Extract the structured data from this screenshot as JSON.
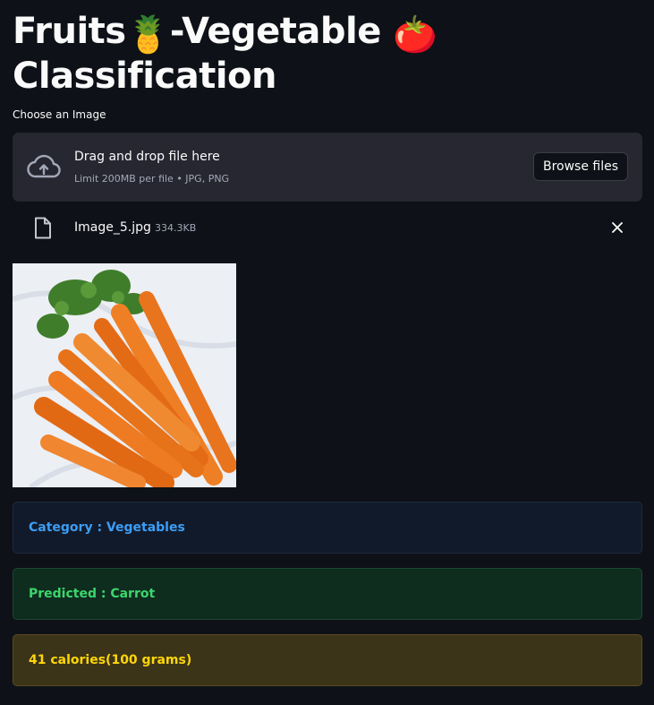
{
  "header": {
    "title_part1": "Fruits",
    "title_part2": "-Vegetable",
    "title_part3": "Classification",
    "emoji1": "🍍",
    "emoji2": "🍅"
  },
  "uploader": {
    "label": "Choose an Image",
    "drop_title": "Drag and drop file here",
    "drop_subtitle": "Limit 200MB per file • JPG, PNG",
    "browse_label": "Browse files",
    "icon": "cloud-upload-icon"
  },
  "file": {
    "name": "Image_5.jpg",
    "size": "334.3KB",
    "icon": "file-icon",
    "remove_icon": "close-icon"
  },
  "results": {
    "category": "Category : Vegetables",
    "predicted": "Predicted : Carrot",
    "calories": "41 calories(100 grams)"
  },
  "colors": {
    "background": "#0e1117",
    "info": "#3d9df3",
    "success": "#3dd56d",
    "warning": "#ffd60a"
  }
}
